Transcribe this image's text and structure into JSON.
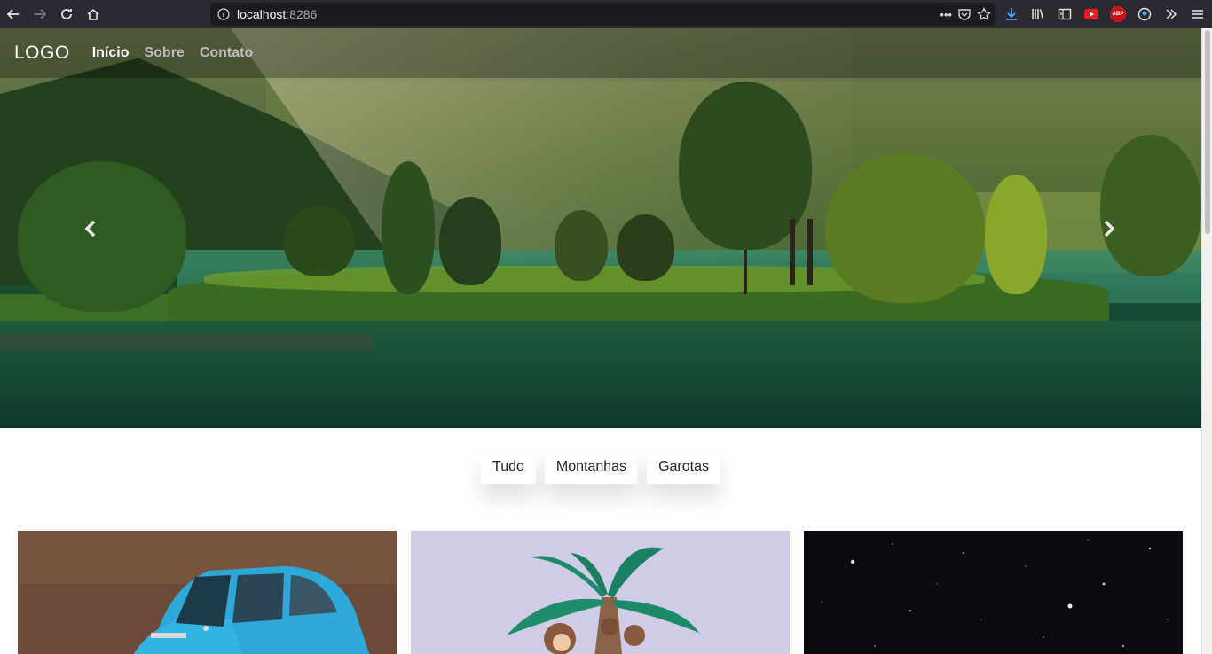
{
  "browser": {
    "url_host": "localhost",
    "url_port": ":8286"
  },
  "site": {
    "logo": "LOGO",
    "nav": [
      {
        "label": "Início",
        "active": true
      },
      {
        "label": "Sobre",
        "active": false
      },
      {
        "label": "Contato",
        "active": false
      }
    ]
  },
  "carousel": {
    "prev_icon": "chevron-left",
    "next_icon": "chevron-right"
  },
  "filters": [
    {
      "label": "Tudo"
    },
    {
      "label": "Montanhas"
    },
    {
      "label": "Garotas"
    }
  ],
  "gallery": [
    {
      "subject": "blue-toy-car"
    },
    {
      "subject": "palm-tree-monkey"
    },
    {
      "subject": "starry-sky"
    }
  ]
}
